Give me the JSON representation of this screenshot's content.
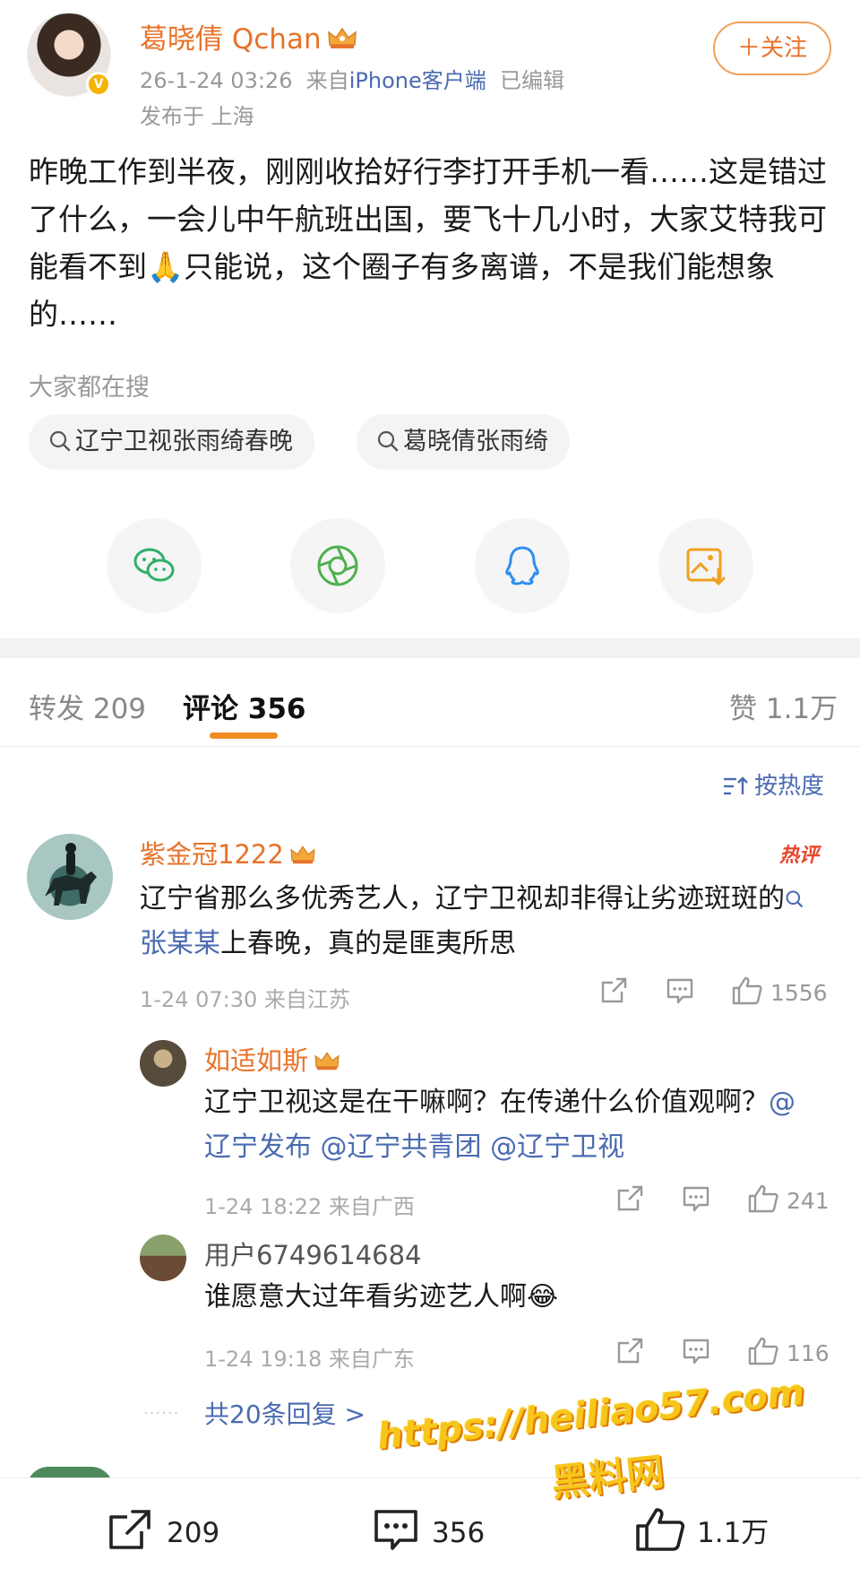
{
  "post": {
    "author": "葛晓倩 Qchan",
    "verified_badge": "V",
    "time": "26-1-24 03:26",
    "from_prefix": "来自",
    "source": "iPhone客户端",
    "edited": "已编辑",
    "location": "发布于 上海",
    "follow_label": "＋关注",
    "text": "昨晚工作到半夜，刚刚收拾好行李打开手机一看……这是错过了什么，一会儿中午航班出国，要飞十几小时，大家艾特我可能看不到🙏只能说，这个圈子有多离谱，不是我们能想象的……"
  },
  "search": {
    "title": "大家都在搜",
    "chips": [
      "辽宁卫视张雨绮春晚",
      "葛晓倩张雨绮"
    ]
  },
  "share_icons": [
    "wechat-icon",
    "moments-icon",
    "qq-icon",
    "save-image-icon"
  ],
  "tabs": {
    "repost": "转发 209",
    "comment": "评论 356",
    "like": "赞 1.1万"
  },
  "sort_label": "按热度",
  "comments": [
    {
      "user": "紫金冠1222",
      "hot": "热评",
      "text_before": "辽宁省那么多优秀艺人，辽宁卫视却非得让劣迹斑斑的",
      "link": "张某某",
      "text_after": "上春晚，真的是匪夷所思",
      "meta": "1-24 07:30 来自江苏",
      "likes": "1556"
    }
  ],
  "replies": [
    {
      "user": "如适如斯",
      "text_before": "辽宁卫视这是在干嘛啊？在传递什么价值观啊？",
      "mentions": "@辽宁发布 @辽宁共青团 @辽宁卫视",
      "meta": "1-24 18:22 来自广西",
      "likes": "241"
    },
    {
      "user": "用户6749614684",
      "text": "谁愿意大过年看劣迹艺人啊😂",
      "meta": "1-24 19:18 来自广东",
      "likes": "116"
    }
  ],
  "more_replies": "共20条回复 >",
  "bottom_bar": {
    "repost": "209",
    "comment": "356",
    "like": "1.1万"
  },
  "watermark": {
    "url": "https://heiliao57.com",
    "name": "黑料网"
  },
  "colors": {
    "accent_orange": "#e8722a",
    "link_blue": "#4a6bb0",
    "tab_underline": "#f28b24"
  }
}
